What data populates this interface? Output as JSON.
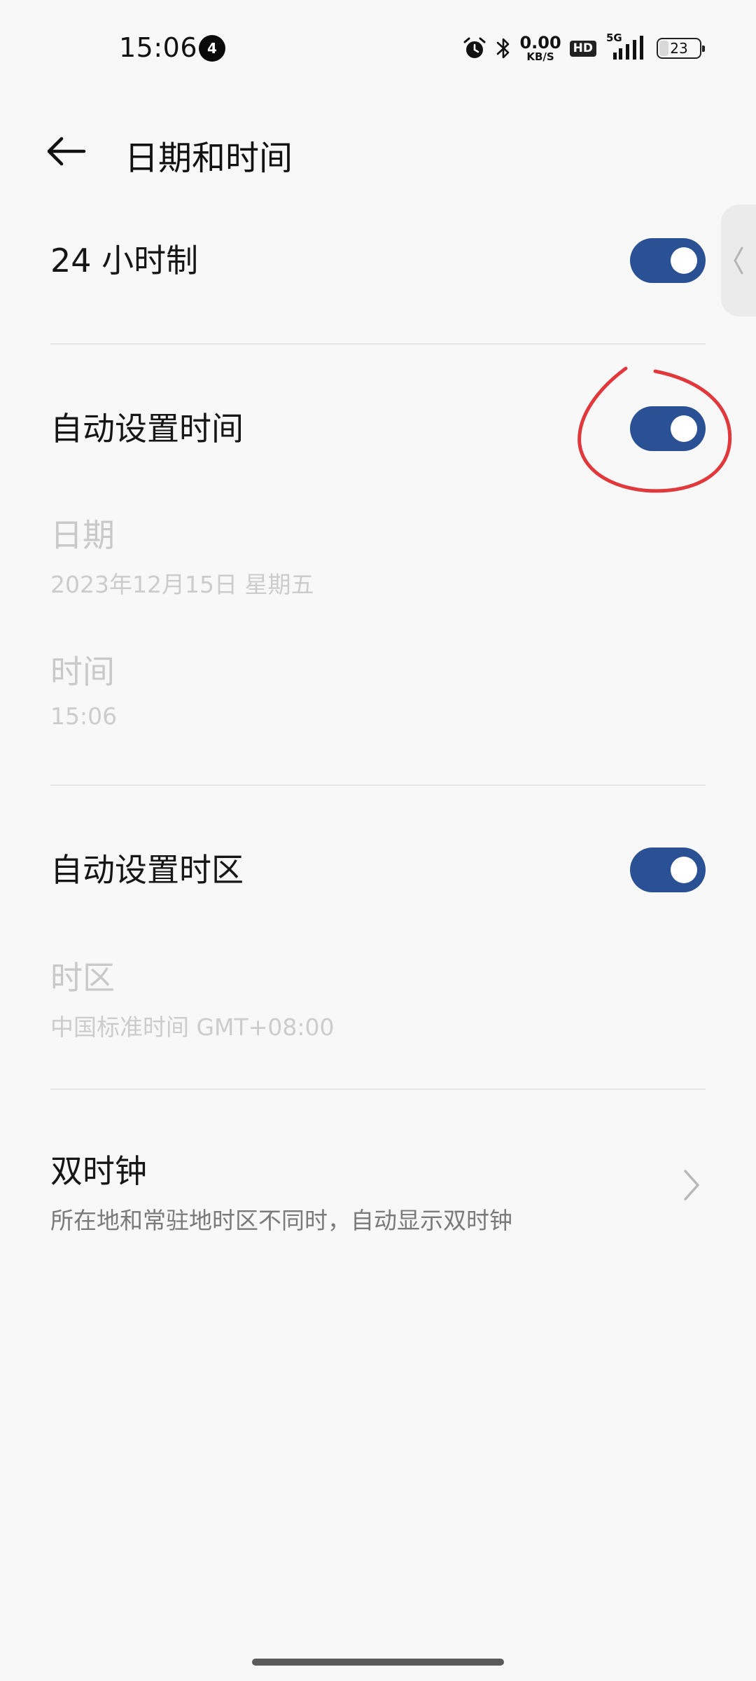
{
  "status_bar": {
    "time": "15:06",
    "notification_count": "4",
    "net_speed_value": "0.00",
    "net_speed_unit": "KB/S",
    "hd_label": "HD",
    "network_type": "5G",
    "battery_level": "23",
    "icons": [
      "alarm-icon",
      "bluetooth-icon",
      "signal-icon",
      "battery-icon"
    ]
  },
  "header": {
    "title": "日期和时间",
    "back_icon": "arrow-left-icon"
  },
  "settings": {
    "hour24": {
      "label": "24 小时制",
      "enabled": true
    },
    "auto_time": {
      "label": "自动设置时间",
      "enabled": true
    },
    "date": {
      "label": "日期",
      "value": "2023年12月15日 星期五",
      "disabled": true
    },
    "time": {
      "label": "时间",
      "value": "15:06",
      "disabled": true
    },
    "auto_timezone": {
      "label": "自动设置时区",
      "enabled": true
    },
    "timezone": {
      "label": "时区",
      "value": "中国标准时间 GMT+08:00",
      "disabled": true
    },
    "dual_clock": {
      "label": "双时钟",
      "description": "所在地和常驻地时区不同时，自动显示双时钟"
    }
  },
  "colors": {
    "toggle_on": "#2a5193",
    "annotation": "#e0383b",
    "background": "#f8f8f8"
  }
}
